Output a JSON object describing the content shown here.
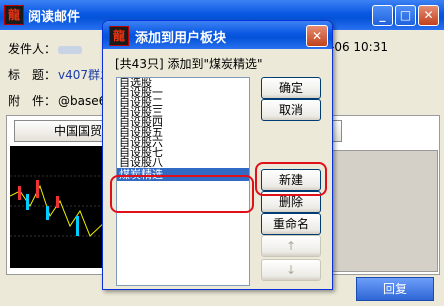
{
  "mail_window": {
    "title": "阅读邮件",
    "from_label": "发件人：",
    "subject_label": "标　题：",
    "subject_value": "v407群发",
    "attach_label": "附　件：",
    "attach_value": "@base64",
    "date": "-06 10:31",
    "content_tab": "中国国贸画线",
    "content_tab2": "贸",
    "reply_button": "回复"
  },
  "dialog": {
    "title": "添加到用户板块",
    "info": "[共43只] 添加到\"煤炭精选\"",
    "close": "✕",
    "list_items": [
      "自选股",
      "自设股一",
      "自设股二",
      "自设股三",
      "自设股四",
      "自设股五",
      "自设股六",
      "自设股七",
      "自设股八",
      "煤炭精选"
    ],
    "selected_index": 9,
    "buttons": {
      "ok": "确定",
      "cancel": "取消",
      "new": "新建",
      "delete": "删除",
      "rename": "重命名",
      "up": "↑",
      "down": "↓"
    }
  },
  "colors": {
    "accent": "#316ac5",
    "highlight_ring": "#e0101a"
  }
}
